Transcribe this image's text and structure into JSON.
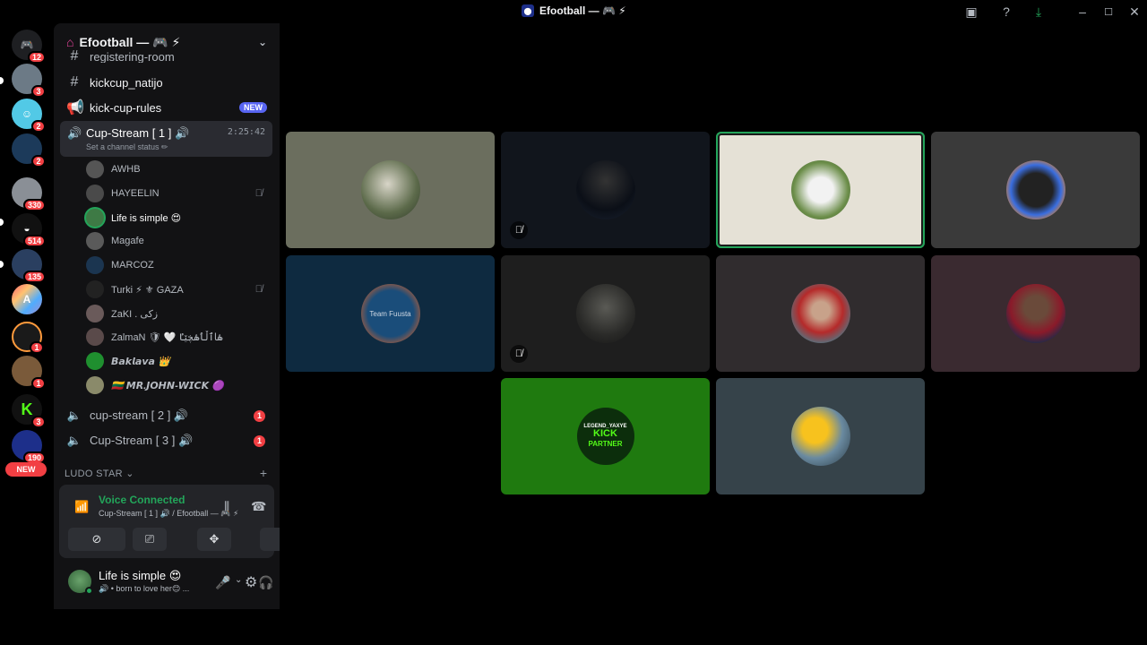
{
  "window": {
    "title": "Efootball — 🎮 ⚡"
  },
  "rail": {
    "badges": [
      "12",
      "3",
      "2",
      "2",
      "330",
      "514",
      "135",
      "1",
      "1",
      "3",
      "190"
    ],
    "new_label": "NEW"
  },
  "server": {
    "name": "Efootball — 🎮 ⚡"
  },
  "channels": {
    "partial": "registering-room",
    "kickcup_natijo": "kickcup_natijo",
    "kick_cup_rules": "kick-cup-rules",
    "new_badge": "NEW",
    "active_voice": {
      "name": "Cup-Stream [ 1 ] 🔊",
      "status": "Set a channel status ✏",
      "timer": "2:25:42"
    },
    "members": [
      {
        "name": "AWHB",
        "muted": false
      },
      {
        "name": "HAYEELIN",
        "muted": true
      },
      {
        "name": "Life is simple 😍",
        "muted": false
      },
      {
        "name": "Magafe",
        "muted": false
      },
      {
        "name": "MARCOZ",
        "muted": false
      },
      {
        "name": "Turki ⚡  ⚜ GAZA",
        "muted": true
      },
      {
        "name": "ZaKI . زکی",
        "muted": false
      },
      {
        "name": "ZalmaN 🛡 🤍 ۿاٱڵٲۿڿێٵ",
        "muted": false
      },
      {
        "name": "𝘽𝙖𝙠𝙡𝙖𝙫𝙖 👑",
        "muted": false
      },
      {
        "name": "🇱🇹 𝙈𝙍.𝙅𝙊𝙃𝙉-𝙒𝙄𝘾𝙆 🟣",
        "muted": false
      }
    ],
    "cup_stream_2": {
      "name": "cup-stream [ 2 ] 🔊",
      "badge": "1"
    },
    "cup_stream_3": {
      "name": "Cup-Stream [ 3 ] 🔊",
      "badge": "1"
    },
    "category": "LUDO STAR ⌄"
  },
  "voice_panel": {
    "title": "Voice Connected",
    "subtitle": "Cup-Stream [ 1 ] 🔊 / Efootball — 🎮 ⚡"
  },
  "user_panel": {
    "name": "Life is simple 😍",
    "status": "🔊 • born to love her😊 ..."
  },
  "tiles": [
    {
      "id": "t1",
      "muted": false
    },
    {
      "id": "t2",
      "muted": true
    },
    {
      "id": "t3",
      "muted": false,
      "active": true
    },
    {
      "id": "t4",
      "muted": false
    },
    {
      "id": "t5",
      "muted": false,
      "label": "Team Fuusta"
    },
    {
      "id": "t6",
      "muted": true
    },
    {
      "id": "t7",
      "muted": false
    },
    {
      "id": "t8",
      "muted": false
    },
    {
      "id": "t9",
      "muted": false,
      "kick_l1": "LEGEND_YAXYE",
      "kick_l2": "KICK",
      "kick_l3": "PARTNER"
    },
    {
      "id": "t10",
      "muted": false
    }
  ],
  "colors": {
    "accent_green": "#23a55a",
    "danger": "#f23f43",
    "blurple": "#5865f2",
    "kick_green": "#53fc18"
  },
  "icons": {
    "mute": "🎙̸"
  }
}
